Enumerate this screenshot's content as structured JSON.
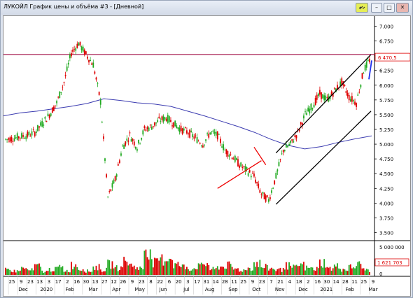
{
  "window": {
    "title": "ЛУКОЙЛ График цены и объёма #3 - [Дневной]",
    "buttons": [
      "link",
      "minimize",
      "maximize",
      "close"
    ]
  },
  "chart_data": [
    {
      "type": "candlestick",
      "price_axis": {
        "ticks": [
          "7.000",
          "6.750",
          "6.500",
          "6.250",
          "6.000",
          "5.750",
          "5.500",
          "5.250",
          "5.000",
          "4.750",
          "4.500",
          "4.250",
          "4.000",
          "3.750",
          "3.500"
        ],
        "ylim": [
          3400,
          7100
        ]
      },
      "current_price_label": "6 470,5",
      "horizontal_line_level": 6520,
      "moving_average": [
        5480,
        5530,
        5560,
        5600,
        5640,
        5690,
        5770,
        5740,
        5700,
        5680,
        5640,
        5560,
        5480,
        5390,
        5300,
        5200,
        5080,
        4980,
        4920,
        4960,
        5030,
        5090,
        5140
      ],
      "close_series": [
        5080,
        5100,
        5130,
        5150,
        5200,
        5350,
        5500,
        5700,
        6050,
        6550,
        6710,
        6520,
        6350,
        5720,
        4100,
        4400,
        4950,
        5150,
        4950,
        5250,
        5300,
        5400,
        5450,
        5350,
        5250,
        5200,
        5100,
        5000,
        5200,
        5150,
        4900,
        4800,
        4650,
        4550,
        4450,
        4150,
        4050,
        4450,
        4900,
        5000,
        5200,
        5500,
        5650,
        5850,
        5750,
        5900,
        6050,
        5800,
        5700,
        6250,
        6470
      ]
    },
    {
      "type": "bar",
      "title": "volume",
      "value_axis_ticks": [
        "5 000 000",
        "0"
      ],
      "current_volume_label": "1 621 703",
      "volume_series": [
        1.2,
        0.9,
        1.5,
        1.1,
        2.0,
        0.8,
        1.3,
        1.7,
        1.0,
        2.3,
        1.4,
        0.9,
        1.8,
        1.2,
        2.5,
        1.6,
        3.1,
        2.2,
        1.5,
        6.4,
        2.8,
        3.6,
        4.1,
        2.4,
        1.9,
        1.5,
        2.0,
        2.6,
        1.3,
        1.9,
        2.2,
        1.4,
        1.1,
        1.6,
        2.7,
        1.8,
        1.5,
        1.2,
        2.1,
        1.7,
        2.3,
        1.6,
        1.4,
        2.9,
        1.5,
        2.0,
        1.3,
        1.8,
        2.4,
        1.2,
        2.6
      ]
    }
  ],
  "time_axis": {
    "days": [
      "25",
      "9",
      "23",
      "13",
      "3",
      "17",
      "2",
      "16",
      "30",
      "13",
      "27",
      "12",
      "26",
      "9",
      "23",
      "8",
      "22",
      "6",
      "20",
      "3",
      "17",
      "31",
      "14",
      "28",
      "11",
      "25",
      "9",
      "23",
      "7",
      "21",
      "4",
      "18",
      "2",
      "16",
      "30",
      "14",
      "28",
      "11",
      "25",
      "9"
    ],
    "months": [
      "Dec",
      "2020",
      "Feb",
      "Mar",
      "Apr",
      "May",
      "Jun",
      "Jul",
      "Aug",
      "Sep",
      "Oct",
      "Nov",
      "Dec",
      "2021",
      "Feb",
      "Mar"
    ]
  },
  "colors": {
    "up": "#22aa22",
    "down": "#dd0000",
    "ma": "#3b3bb0",
    "hline": "#aa2255",
    "channel": "#000000",
    "trend": "#ee0000"
  }
}
